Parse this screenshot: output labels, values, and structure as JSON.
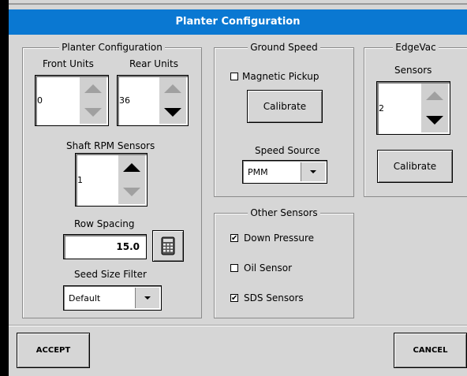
{
  "window": {
    "title": "Planter Configuration"
  },
  "planter": {
    "legend": "Planter Configuration",
    "front_label": "Front Units",
    "front_value": "0",
    "rear_label": "Rear Units",
    "rear_value": "36",
    "shaft_label": "Shaft RPM Sensors",
    "shaft_value": "1",
    "row_spacing_label": "Row Spacing",
    "row_spacing_value": "15.0",
    "seed_filter_label": "Seed Size Filter",
    "seed_filter_value": "Default"
  },
  "ground_speed": {
    "legend": "Ground Speed",
    "magnetic_label": "Magnetic Pickup",
    "magnetic_checked": false,
    "calibrate_label": "Calibrate",
    "source_label": "Speed Source",
    "source_value": "PMM"
  },
  "edgevac": {
    "legend": "EdgeVac",
    "sensors_label": "Sensors",
    "sensors_value": "2",
    "calibrate_label": "Calibrate"
  },
  "other_sensors": {
    "legend": "Other Sensors",
    "items": [
      {
        "label": "Down Pressure",
        "checked": true,
        "mark": "✔"
      },
      {
        "label": "Oil Sensor",
        "checked": false,
        "mark": ""
      },
      {
        "label": "SDS Sensors",
        "checked": true,
        "mark": "✔"
      }
    ]
  },
  "footer": {
    "accept_label": "ACCEPT",
    "cancel_label": "CANCEL"
  },
  "colors": {
    "title_bar": "#0a78d2",
    "background": "#d6d6d6"
  }
}
